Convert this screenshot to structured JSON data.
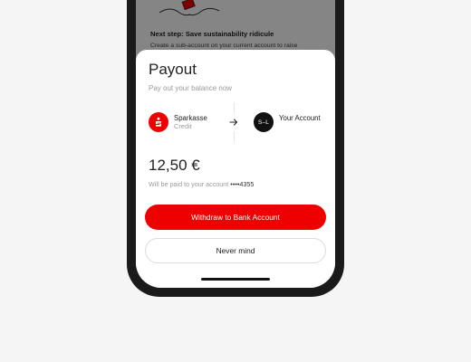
{
  "background_screen": {
    "next_step_title": "Next step: Save sustainability ridicule",
    "next_step_text": "Create a sub-account on your current account to raise"
  },
  "payout_sheet": {
    "title": "Payout",
    "subtitle": "Pay out your balance now",
    "from": {
      "name": "Sparkasse",
      "sub": "Credit",
      "logo_icon": "sparkasse-s-icon",
      "color": "#ee0000"
    },
    "to": {
      "logo_text": "S–L",
      "name": "Your Account"
    },
    "amount": "12,50 €",
    "note_prefix": "Will be paid to your account",
    "note_masked": "••••4355",
    "primary_button": "Withdraw to Bank Account",
    "secondary_button": "Never mind"
  },
  "colors": {
    "accent": "#ee0000",
    "text": "#222222",
    "muted": "#9a9a9a"
  }
}
